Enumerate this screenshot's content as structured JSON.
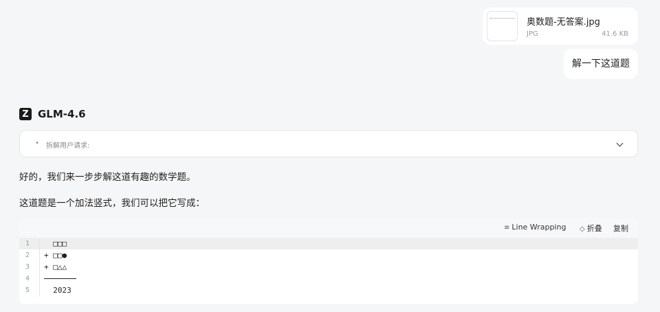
{
  "file": {
    "name": "奥数题-无答案.jpg",
    "type": "JPG",
    "size": "41.6 KB"
  },
  "user_message": "解一下这道题",
  "model": {
    "logo_letter": "Z",
    "name": "GLM-4.6"
  },
  "thinking": {
    "bullet": "•",
    "text": "拆解用户请求:"
  },
  "response": {
    "para1": "好的，我们来一步步解这道有趣的数学题。",
    "para2": "这道题是一个加法竖式，我们可以把它写成："
  },
  "code": {
    "toolbar": {
      "wrap_label": "Line Wrapping",
      "fold_label": "折叠",
      "copy_label": "复制"
    },
    "lines": [
      {
        "num": "1",
        "text": "  □□□"
      },
      {
        "num": "2",
        "text": "+ □□●"
      },
      {
        "num": "3",
        "text": "+ □△△"
      },
      {
        "num": "4",
        "text": ""
      },
      {
        "num": "5",
        "text": "  2023"
      }
    ]
  },
  "icons": {
    "wrap": "wrap-icon",
    "fold": "fold-icon",
    "chevron": "chevron-down-icon"
  },
  "colors": {
    "background": "#f5f6f7",
    "card": "#ffffff",
    "muted_text": "#9a9a9a",
    "logo_bg": "#1a1a1a"
  }
}
